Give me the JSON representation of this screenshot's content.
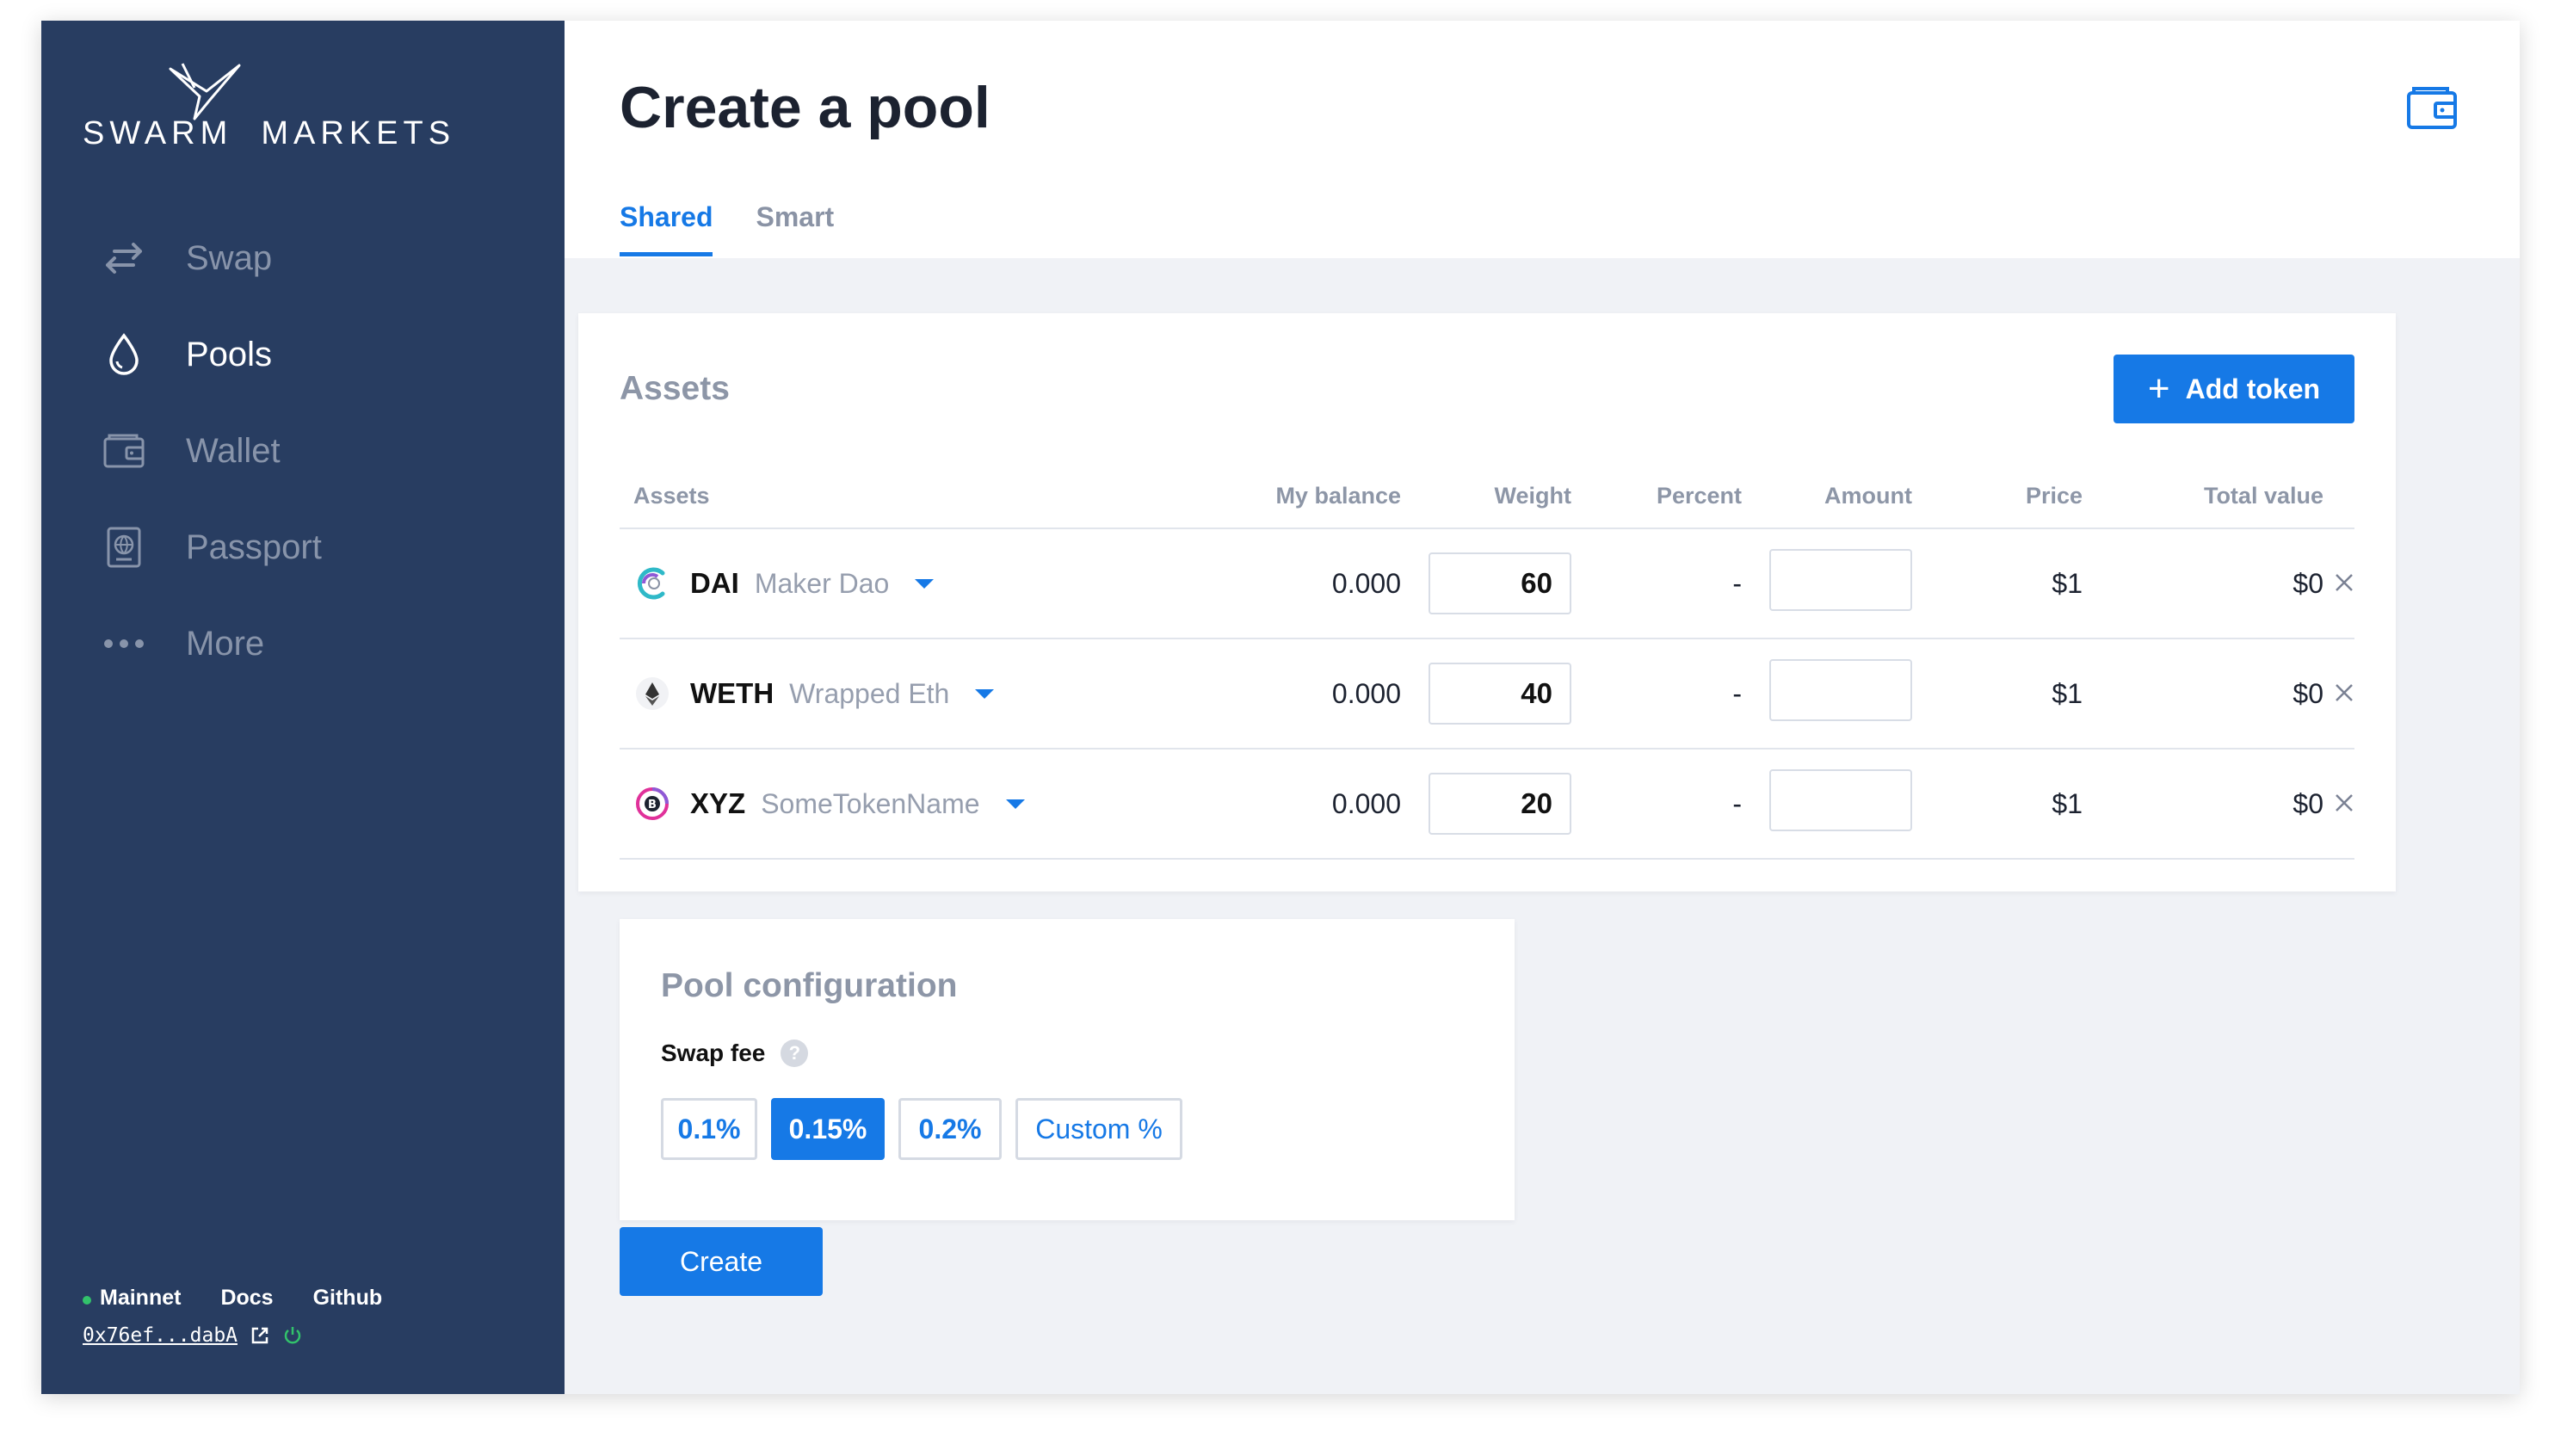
{
  "brand": {
    "logo_left": "SWARM",
    "logo_right": "MARKETS"
  },
  "sidebar": {
    "items": [
      {
        "label": "Swap",
        "icon": "swap-arrows-icon",
        "active": false
      },
      {
        "label": "Pools",
        "icon": "droplet-icon",
        "active": true
      },
      {
        "label": "Wallet",
        "icon": "wallet-icon",
        "active": false
      },
      {
        "label": "Passport",
        "icon": "passport-icon",
        "active": false
      },
      {
        "label": "More",
        "icon": "more-dots-icon",
        "active": false
      }
    ],
    "footer": {
      "network": "Mainnet",
      "docs": "Docs",
      "github": "Github",
      "address": "0x76ef...dabA"
    }
  },
  "header": {
    "title": "Create a pool",
    "tabs": [
      {
        "label": "Shared",
        "active": true
      },
      {
        "label": "Smart",
        "active": false
      }
    ]
  },
  "assets": {
    "title": "Assets",
    "add_token_label": "Add token",
    "columns": [
      "Assets",
      "My balance",
      "Weight",
      "Percent",
      "Amount",
      "Price",
      "Total value"
    ],
    "rows": [
      {
        "symbol": "DAI",
        "name": "Maker Dao",
        "balance": "0.000",
        "weight": "60",
        "percent": "-",
        "amount": "",
        "price": "$1",
        "total": "$0"
      },
      {
        "symbol": "WETH",
        "name": "Wrapped Eth",
        "balance": "0.000",
        "weight": "40",
        "percent": "-",
        "amount": "",
        "price": "$1",
        "total": "$0"
      },
      {
        "symbol": "XYZ",
        "name": "SomeTokenName",
        "balance": "0.000",
        "weight": "20",
        "percent": "-",
        "amount": "",
        "price": "$1",
        "total": "$0"
      }
    ]
  },
  "pool_config": {
    "title": "Pool configuration",
    "swap_fee_label": "Swap fee",
    "help": "?",
    "fees": [
      "0.1%",
      "0.15%",
      "0.2%"
    ],
    "custom_label": "Custom %",
    "selected_fee": "0.15%"
  },
  "create_label": "Create",
  "colors": {
    "sidebar": "#283d61",
    "accent": "#1679e6",
    "background": "#f0f2f6",
    "online": "#32c26b"
  }
}
